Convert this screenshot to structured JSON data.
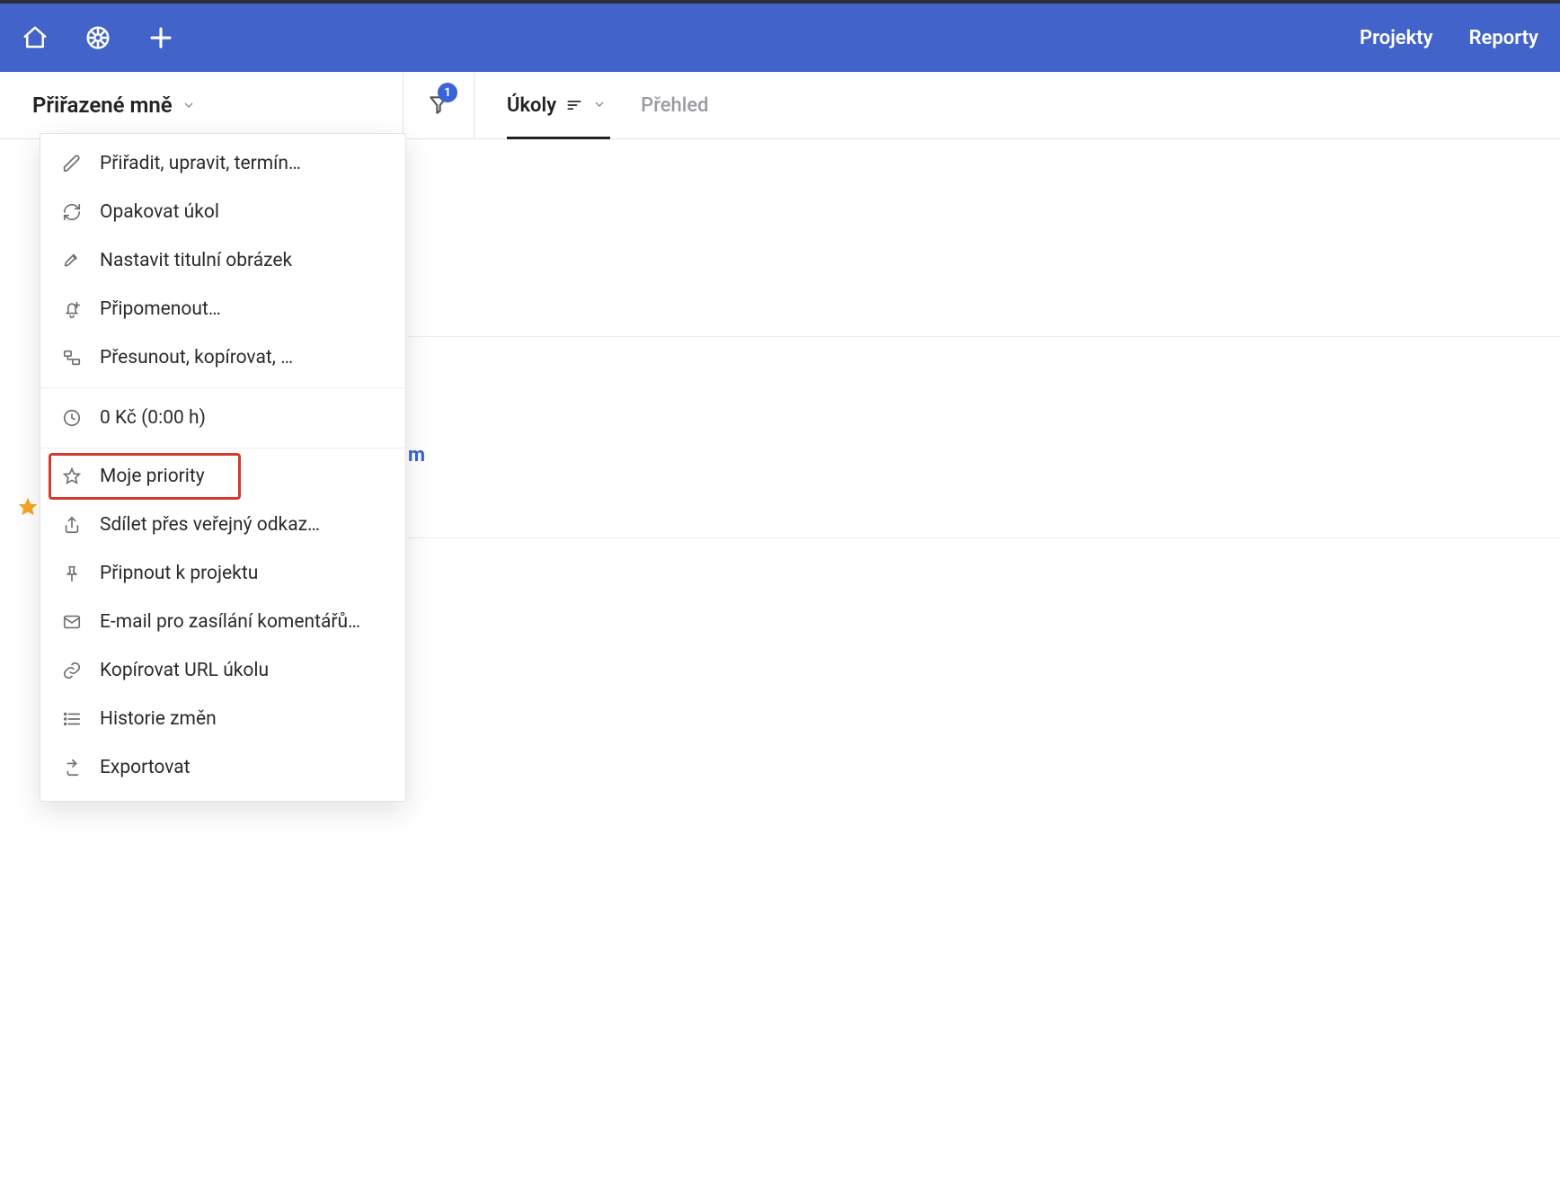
{
  "topbar": {
    "links": {
      "projects": "Projekty",
      "reports": "Reporty"
    }
  },
  "subbar": {
    "dropdown_label": "Přiřazené mně",
    "filter_badge": "1",
    "tabs": {
      "tasks": "Úkoly",
      "overview": "Přehled"
    }
  },
  "bg": {
    "hint_suffix": "m"
  },
  "menu": {
    "assign_edit_due": "Přiřadit, upravit, termín…",
    "repeat_task": "Opakovat úkol",
    "set_cover_image": "Nastavit titulní obrázek",
    "remind": "Připomenout…",
    "move_copy": "Přesunout, kopírovat, …",
    "time_cost": "0 Kč (0:00 h)",
    "my_priorities": "Moje priority",
    "share_public_link": "Sdílet přes veřejný odkaz…",
    "pin_to_project": "Připnout k projektu",
    "email_for_comments": "E-mail pro zasílání komentářů…",
    "copy_task_url": "Kopírovat URL úkolu",
    "change_history": "Historie změn",
    "export": "Exportovat"
  }
}
